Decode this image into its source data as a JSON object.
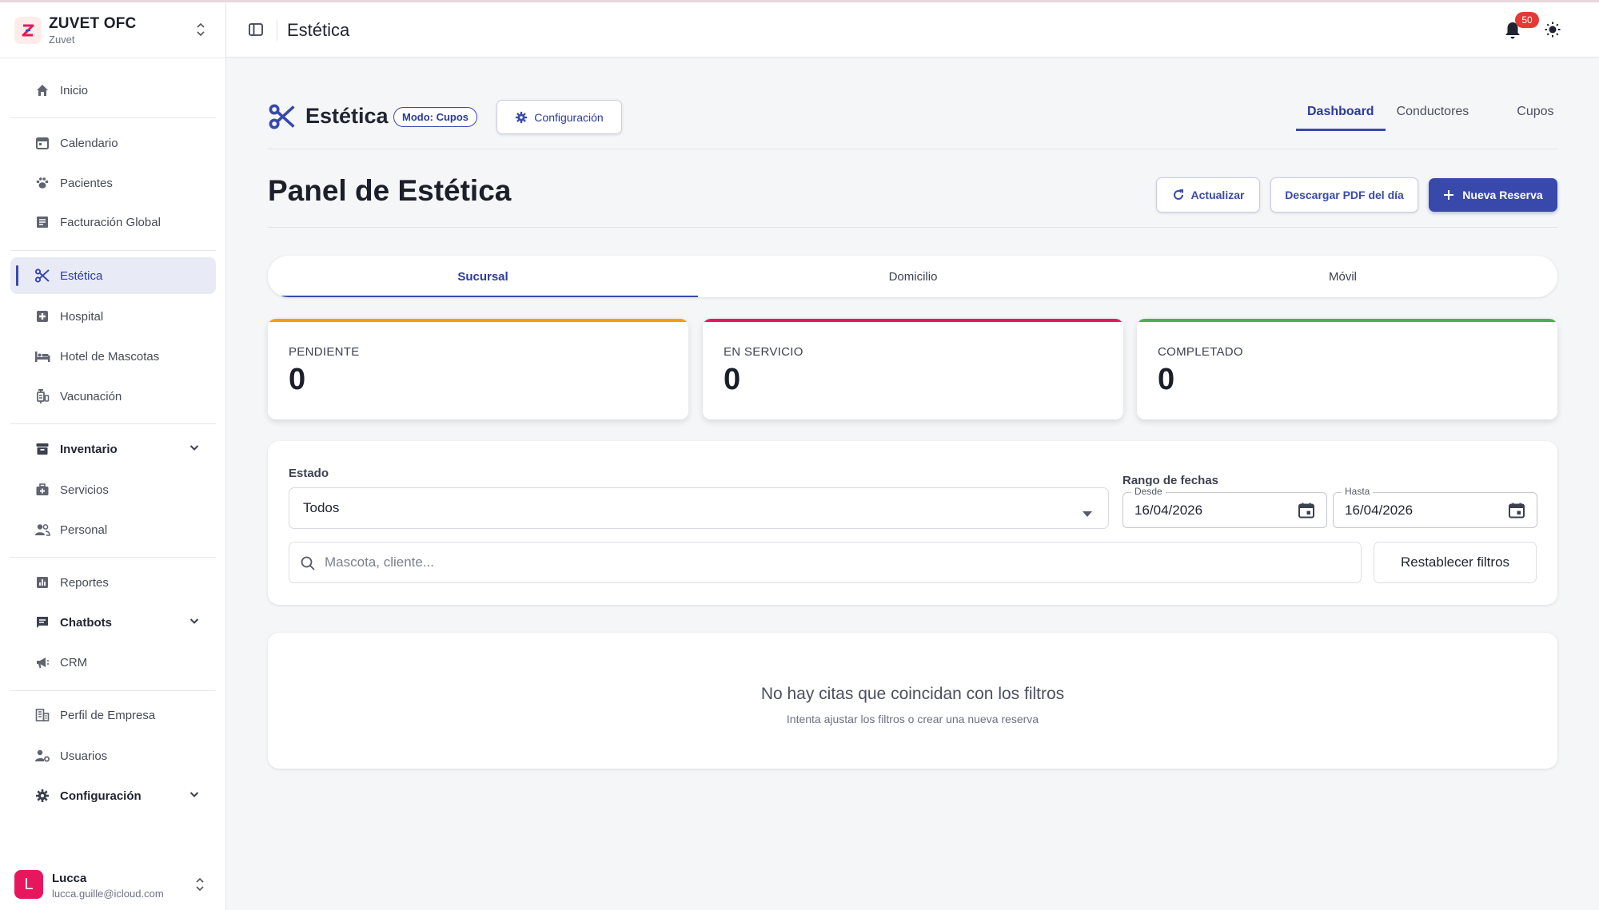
{
  "colors": {
    "accent": "#3949ab",
    "pending": "#f59e0b",
    "in_service": "#e8175d",
    "completed": "#4caf50",
    "badge": "#e53935"
  },
  "brand": {
    "title": "ZUVET OFC",
    "subtitle": "Zuvet",
    "logo_icon": "zuvet-logo"
  },
  "sidebar": {
    "items": [
      {
        "label": "Inicio",
        "icon": "home-icon"
      },
      {
        "label": "Calendario",
        "icon": "calendar-icon"
      },
      {
        "label": "Pacientes",
        "icon": "paw-icon"
      },
      {
        "label": "Facturación Global",
        "icon": "receipt-icon"
      },
      {
        "label": "Estética",
        "icon": "scissors-icon"
      },
      {
        "label": "Hospital",
        "icon": "hospital-icon"
      },
      {
        "label": "Hotel de Mascotas",
        "icon": "bed-icon"
      },
      {
        "label": "Vacunación",
        "icon": "syringe-icon"
      },
      {
        "label": "Inventario",
        "icon": "archive-icon"
      },
      {
        "label": "Servicios",
        "icon": "medkit-icon"
      },
      {
        "label": "Personal",
        "icon": "people-icon"
      },
      {
        "label": "Reportes",
        "icon": "report-icon"
      },
      {
        "label": "Chatbots",
        "icon": "chat-icon"
      },
      {
        "label": "CRM",
        "icon": "megaphone-icon"
      },
      {
        "label": "Perfil de Empresa",
        "icon": "building-icon"
      },
      {
        "label": "Usuarios",
        "icon": "user-gear-icon"
      },
      {
        "label": "Configuración",
        "icon": "gear-icon"
      }
    ]
  },
  "user": {
    "initial": "L",
    "name": "Lucca",
    "email": "lucca.guille@icloud.com"
  },
  "header": {
    "title": "Estética",
    "notifications": "50"
  },
  "module": {
    "title": "Estética",
    "mode_chip": "Modo: Cupos",
    "config_button": "Configuración",
    "tabs": [
      "Dashboard",
      "Conductores",
      "Cupos"
    ],
    "active_tab": "Dashboard"
  },
  "page": {
    "title": "Panel de Estética",
    "refresh_button": "Actualizar",
    "pdf_button": "Descargar PDF del día",
    "new_button": "Nueva Reserva"
  },
  "location_tabs": [
    "Sucursal",
    "Domicilio",
    "Móvil"
  ],
  "active_location_tab": "Sucursal",
  "stats": [
    {
      "label": "PENDIENTE",
      "value": "0"
    },
    {
      "label": "EN SERVICIO",
      "value": "0"
    },
    {
      "label": "COMPLETADO",
      "value": "0"
    }
  ],
  "filters": {
    "status_label": "Estado",
    "status_value": "Todos",
    "date_range_label": "Rango de fechas",
    "from_legend": "Desde",
    "from_value": "16/04/2026",
    "to_legend": "Hasta",
    "to_value": "16/04/2026",
    "search_placeholder": "Mascota, cliente...",
    "reset_button": "Restablecer filtros"
  },
  "empty_state": {
    "title": "No hay citas que coincidan con los filtros",
    "subtitle": "Intenta ajustar los filtros o crear una nueva reserva"
  }
}
